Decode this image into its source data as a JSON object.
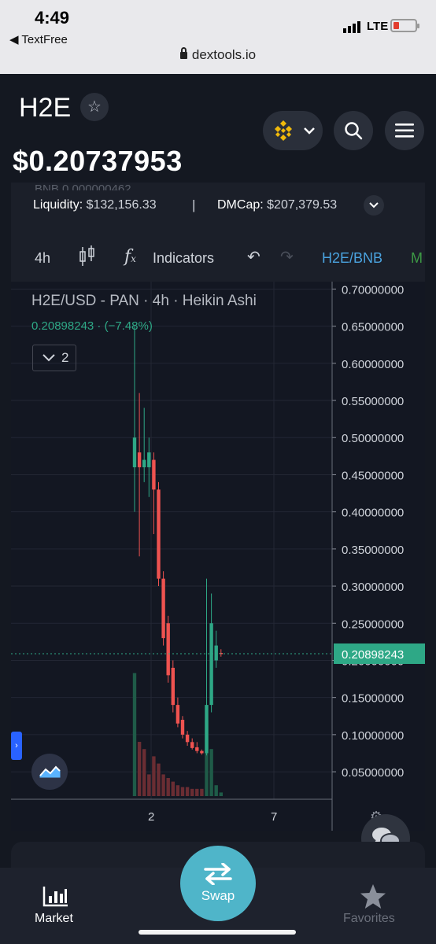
{
  "status_bar": {
    "time": "4:49",
    "back_app": "◀ TextFree",
    "network": "LTE",
    "url": "dextools.io"
  },
  "header": {
    "token_symbol": "H2E",
    "price": "$0.20737953",
    "chain_icon": "bnb-chain-icon",
    "accent_color": "#f0b90b"
  },
  "info": {
    "faded_row": "BNB 0.000000462",
    "liquidity_label": "Liquidity:",
    "liquidity_value": "$132,156.33",
    "separator": "|",
    "dmcap_label": "DMCap:",
    "dmcap_value": "$207,379.53"
  },
  "toolbar": {
    "interval": "4h",
    "indicators": "Indicators",
    "pair": "H2E/BNB",
    "more": "M"
  },
  "chart_legend": {
    "title": "H2E/USD - PAN · 4h · Heikin Ashi",
    "value": "0.20898243 · (−7.48%)",
    "toggle_count": "2"
  },
  "chart_data": {
    "type": "candlestick",
    "title": "H2E/USD - PAN · 4h · Heikin Ashi",
    "y_ticks": [
      "0.70000000",
      "0.65000000",
      "0.60000000",
      "0.55000000",
      "0.50000000",
      "0.45000000",
      "0.40000000",
      "0.35000000",
      "0.30000000",
      "0.25000000",
      "0.20000000",
      "0.15000000",
      "0.10000000",
      "0.05000000"
    ],
    "y_tick_values": [
      0.7,
      0.65,
      0.6,
      0.55,
      0.5,
      0.45,
      0.4,
      0.35,
      0.3,
      0.25,
      0.2,
      0.15,
      0.1,
      0.05
    ],
    "ylim": [
      0.013,
      0.71
    ],
    "x_ticks": [
      "2",
      "7"
    ],
    "current_price_label": "0.20898243",
    "up_color": "#2ea886",
    "down_color": "#ef5350",
    "candles": [
      {
        "o": 0.46,
        "h": 0.65,
        "l": 0.4,
        "c": 0.5
      },
      {
        "o": 0.48,
        "h": 0.56,
        "l": 0.34,
        "c": 0.46
      },
      {
        "o": 0.46,
        "h": 0.54,
        "l": 0.44,
        "c": 0.47
      },
      {
        "o": 0.46,
        "h": 0.5,
        "l": 0.42,
        "c": 0.48
      },
      {
        "o": 0.47,
        "h": 0.48,
        "l": 0.37,
        "c": 0.43
      },
      {
        "o": 0.43,
        "h": 0.44,
        "l": 0.3,
        "c": 0.31
      },
      {
        "o": 0.31,
        "h": 0.32,
        "l": 0.22,
        "c": 0.23
      },
      {
        "o": 0.25,
        "h": 0.26,
        "l": 0.17,
        "c": 0.18
      },
      {
        "o": 0.19,
        "h": 0.2,
        "l": 0.13,
        "c": 0.14
      },
      {
        "o": 0.14,
        "h": 0.15,
        "l": 0.11,
        "c": 0.115
      },
      {
        "o": 0.12,
        "h": 0.125,
        "l": 0.095,
        "c": 0.1
      },
      {
        "o": 0.1,
        "h": 0.105,
        "l": 0.085,
        "c": 0.09
      },
      {
        "o": 0.09,
        "h": 0.095,
        "l": 0.08,
        "c": 0.082
      },
      {
        "o": 0.083,
        "h": 0.09,
        "l": 0.075,
        "c": 0.078
      },
      {
        "o": 0.078,
        "h": 0.08,
        "l": 0.073,
        "c": 0.075
      },
      {
        "o": 0.075,
        "h": 0.31,
        "l": 0.072,
        "c": 0.14
      },
      {
        "o": 0.14,
        "h": 0.29,
        "l": 0.13,
        "c": 0.25
      },
      {
        "o": 0.2,
        "h": 0.24,
        "l": 0.19,
        "c": 0.22
      },
      {
        "o": 0.21,
        "h": 0.215,
        "l": 0.205,
        "c": 0.209
      }
    ],
    "volumes": [
      0.68,
      0.3,
      0.26,
      0.12,
      0.22,
      0.18,
      0.12,
      0.1,
      0.08,
      0.06,
      0.05,
      0.05,
      0.04,
      0.04,
      0.04,
      0.42,
      0.26,
      0.06,
      0.02
    ],
    "volume_colors": [
      "up",
      "down",
      "down",
      "down",
      "down",
      "down",
      "down",
      "down",
      "down",
      "down",
      "down",
      "down",
      "down",
      "down",
      "down",
      "up",
      "up",
      "up",
      "up"
    ]
  },
  "bottom_nav": {
    "market": "Market",
    "swap": "Swap",
    "favorites": "Favorites"
  }
}
